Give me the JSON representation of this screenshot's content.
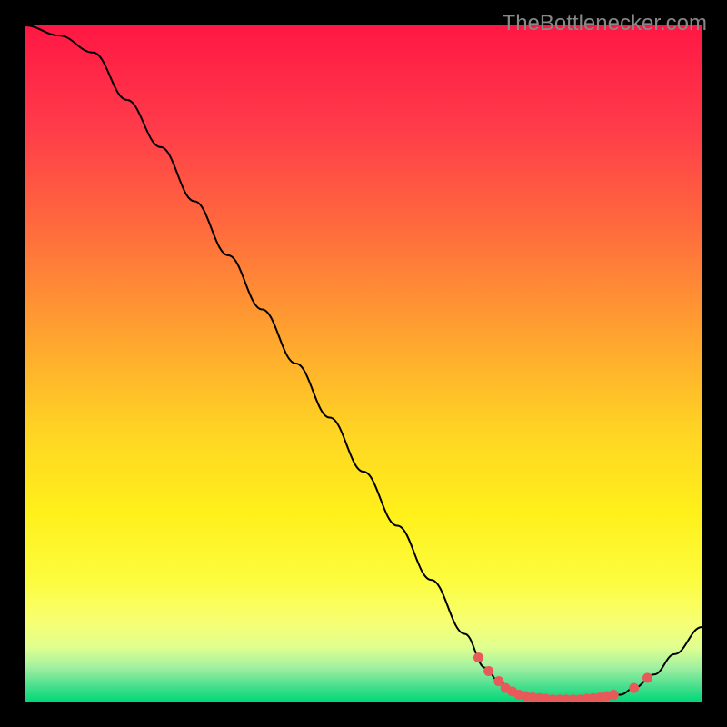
{
  "watermark": "TheBottlenecker.com",
  "chart_data": {
    "type": "line",
    "title": "",
    "xlabel": "",
    "ylabel": "",
    "xlim": [
      0,
      100
    ],
    "ylim": [
      0,
      100
    ],
    "curve": [
      {
        "x": 0,
        "y": 100
      },
      {
        "x": 5,
        "y": 98.5
      },
      {
        "x": 10,
        "y": 96
      },
      {
        "x": 15,
        "y": 89
      },
      {
        "x": 20,
        "y": 82
      },
      {
        "x": 25,
        "y": 74
      },
      {
        "x": 30,
        "y": 66
      },
      {
        "x": 35,
        "y": 58
      },
      {
        "x": 40,
        "y": 50
      },
      {
        "x": 45,
        "y": 42
      },
      {
        "x": 50,
        "y": 34
      },
      {
        "x": 55,
        "y": 26
      },
      {
        "x": 60,
        "y": 18
      },
      {
        "x": 65,
        "y": 10
      },
      {
        "x": 68,
        "y": 5
      },
      {
        "x": 70,
        "y": 3
      },
      {
        "x": 72,
        "y": 1.5
      },
      {
        "x": 75,
        "y": 0.5
      },
      {
        "x": 80,
        "y": 0.3
      },
      {
        "x": 85,
        "y": 0.5
      },
      {
        "x": 88,
        "y": 1
      },
      {
        "x": 90,
        "y": 2
      },
      {
        "x": 93,
        "y": 4
      },
      {
        "x": 96,
        "y": 7
      },
      {
        "x": 100,
        "y": 11
      }
    ],
    "dots": [
      {
        "x": 67,
        "y": 6.5
      },
      {
        "x": 68.5,
        "y": 4.5
      },
      {
        "x": 70,
        "y": 3
      },
      {
        "x": 71,
        "y": 2
      },
      {
        "x": 72,
        "y": 1.5
      },
      {
        "x": 73,
        "y": 1
      },
      {
        "x": 74,
        "y": 0.8
      },
      {
        "x": 75,
        "y": 0.6
      },
      {
        "x": 76,
        "y": 0.5
      },
      {
        "x": 77,
        "y": 0.4
      },
      {
        "x": 78,
        "y": 0.3
      },
      {
        "x": 79,
        "y": 0.3
      },
      {
        "x": 80,
        "y": 0.3
      },
      {
        "x": 81,
        "y": 0.3
      },
      {
        "x": 82,
        "y": 0.3
      },
      {
        "x": 83,
        "y": 0.4
      },
      {
        "x": 84,
        "y": 0.5
      },
      {
        "x": 85,
        "y": 0.6
      },
      {
        "x": 86,
        "y": 0.8
      },
      {
        "x": 87,
        "y": 1
      },
      {
        "x": 90,
        "y": 2
      },
      {
        "x": 92,
        "y": 3.5
      }
    ],
    "gradient_stops": [
      {
        "offset": 0,
        "color": "#ff1744"
      },
      {
        "offset": 15,
        "color": "#ff3b4a"
      },
      {
        "offset": 30,
        "color": "#ff6b3d"
      },
      {
        "offset": 45,
        "color": "#ffa030"
      },
      {
        "offset": 60,
        "color": "#ffd424"
      },
      {
        "offset": 72,
        "color": "#fff01a"
      },
      {
        "offset": 82,
        "color": "#fcfc3e"
      },
      {
        "offset": 88,
        "color": "#f8ff70"
      },
      {
        "offset": 92,
        "color": "#e0ff90"
      },
      {
        "offset": 95,
        "color": "#a0f0a0"
      },
      {
        "offset": 97.5,
        "color": "#50e090"
      },
      {
        "offset": 100,
        "color": "#00d877"
      }
    ],
    "dot_color": "#e85a5a",
    "line_color": "#000000"
  }
}
